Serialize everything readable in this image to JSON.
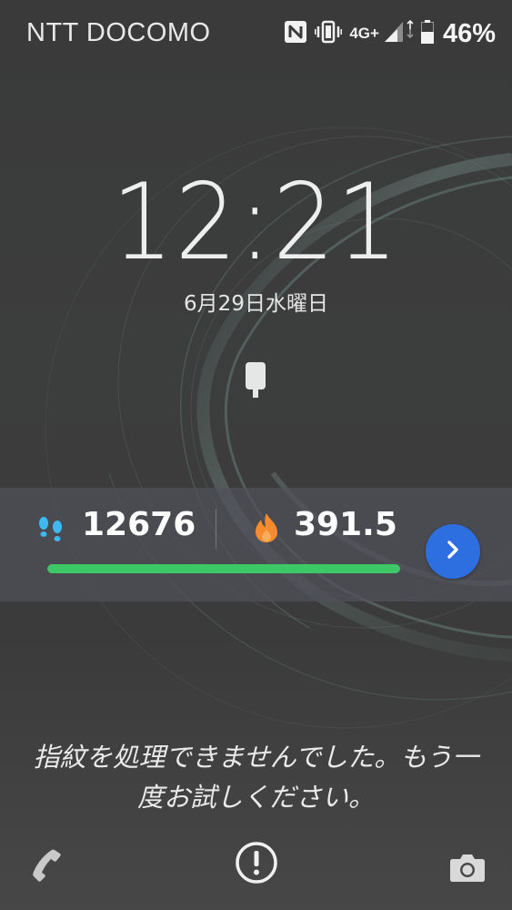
{
  "status_bar": {
    "carrier": "NTT DOCOMO",
    "network_type": "4G+",
    "battery_percent_label": "46%",
    "battery_level": 0.46,
    "icons": [
      "nfc-icon",
      "vibrate-icon",
      "signal-icon",
      "battery-icon"
    ]
  },
  "lock_screen": {
    "time": "12:21",
    "date": "6月29日水曜日",
    "voice_icon": "microphone-icon"
  },
  "fitness_widget": {
    "steps": "12676",
    "calories": "391.5",
    "steps_icon": "footprints-icon",
    "calories_icon": "flame-icon",
    "progress": 1.0,
    "progress_color": "#3cc867",
    "button_icon": "chevron-right-icon",
    "button_color": "#2d6fe0"
  },
  "fingerprint": {
    "message_line1": "指紋を処理できませんでした。もう一",
    "message_line2": "度お試しください。"
  },
  "shortcuts": {
    "left": "phone-icon",
    "center": "alert-circle-icon",
    "right": "camera-icon"
  }
}
